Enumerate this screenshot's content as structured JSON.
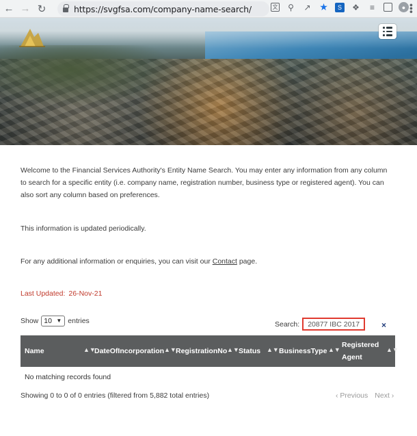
{
  "browser": {
    "url": "https://svgfsa.com/company-name-search/",
    "back_icon": "back-arrow-icon",
    "forward_icon": "forward-arrow-icon",
    "reload_icon": "reload-icon"
  },
  "intro": {
    "text": "Welcome to the Financial Services Authority's Entity Name Search. You may enter any information from any column to search for a specific entity (i.e. company name, registration number, business type or registered agent). You can also sort any column based on preferences.",
    "periodic": "This information is updated periodically.",
    "contact_prefix": "For any additional information or enquiries, you can visit our ",
    "contact_link": "Contact",
    "contact_suffix": " page."
  },
  "last_updated": {
    "label": "Last Updated:",
    "date": "26-Nov-21"
  },
  "table_controls": {
    "show_label": "Show",
    "page_length": "10",
    "entries_label": "entries",
    "search_label": "Search:",
    "search_value": "20877 IBC 2017",
    "clear_symbol": "×"
  },
  "table": {
    "columns": [
      "Name",
      "DateOfIncorporation",
      "RegistrationNo",
      "Status",
      "BusinessType",
      "Registered Agent"
    ],
    "empty_message": "No matching records found"
  },
  "footer": {
    "info": "Showing 0 to 0 of 0 entries (filtered from 5,882 total entries)",
    "previous": "Previous",
    "next": "Next"
  },
  "colors": {
    "header_bg": "#5b5d5e",
    "last_updated": "#c0392b",
    "search_highlight": "#e03a2f",
    "link_blue": "#1a73e8"
  }
}
